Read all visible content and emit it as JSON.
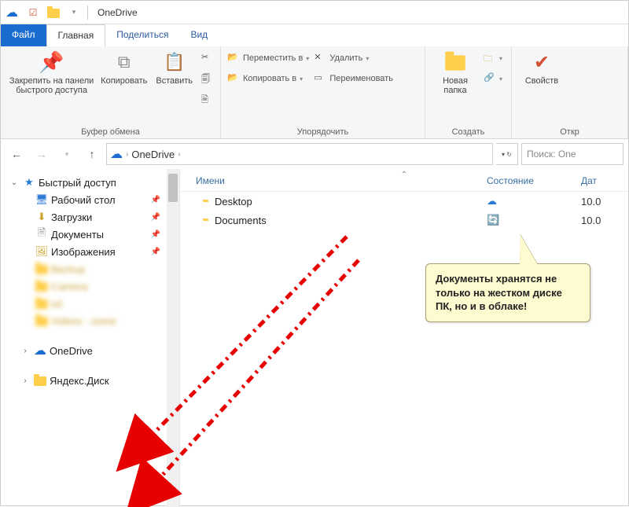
{
  "window": {
    "title": "OneDrive"
  },
  "tabs": {
    "file": "Файл",
    "home": "Главная",
    "share": "Поделиться",
    "view": "Вид"
  },
  "ribbon": {
    "clipboard": {
      "name": "Буфер обмена",
      "pin": "Закрепить на панели быстрого доступа",
      "copy": "Копировать",
      "paste": "Вставить"
    },
    "organize": {
      "name": "Упорядочить",
      "move_to": "Переместить в",
      "copy_to": "Копировать в",
      "delete": "Удалить",
      "rename": "Переименовать"
    },
    "create": {
      "name": "Создать",
      "new_folder": "Новая\nпапка"
    },
    "open": {
      "name": "Откр",
      "properties": "Свойств"
    }
  },
  "nav": {
    "location": "OneDrive",
    "search_placeholder": "Поиск: One"
  },
  "tree": {
    "quick_access": "Быстрый доступ",
    "desktop": "Рабочий стол",
    "downloads": "Загрузки",
    "documents": "Документы",
    "pictures": "Изображения",
    "onedrive": "OneDrive",
    "yandex_disk": "Яндекс.Диск",
    "blurred": [
      "Backup",
      "Camera",
      "sd",
      "Videos - some"
    ]
  },
  "columns": {
    "name": "Имени",
    "state": "Состояние",
    "date": "Дат"
  },
  "rows": [
    {
      "name": "Desktop",
      "state_icon": "cloud",
      "date": "10.0"
    },
    {
      "name": "Documents",
      "state_icon": "sync",
      "date": "10.0"
    }
  ],
  "callout": {
    "text": "Документы хранятся не только на жестком диске ПК, но и в облаке!"
  }
}
